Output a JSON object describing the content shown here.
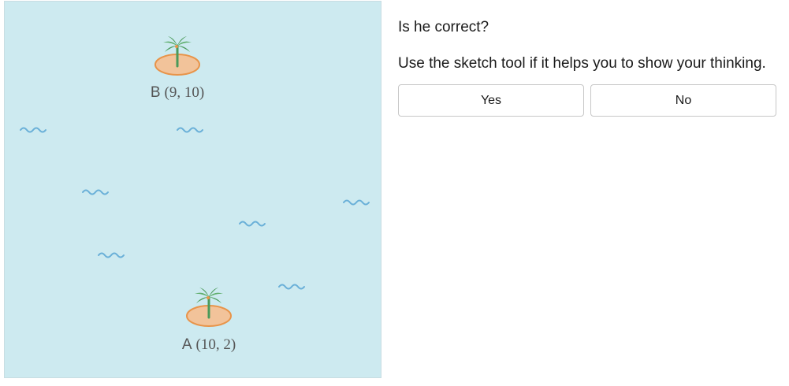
{
  "question": "Is he correct?",
  "instruction": "Use the sketch tool if it helps you to show your thinking.",
  "answers": {
    "yes_label": "Yes",
    "no_label": "No"
  },
  "map": {
    "sea_color": "#cdeaf0",
    "wave_color": "#6ab0d8",
    "island_sand_color": "#f2c39a",
    "island_rim_color": "#e8944a",
    "palm_color": "#4a9a5a",
    "islands": [
      {
        "letter": "B",
        "coords": "(9, 10)"
      },
      {
        "letter": "A",
        "coords": "(10, 2)"
      }
    ]
  }
}
